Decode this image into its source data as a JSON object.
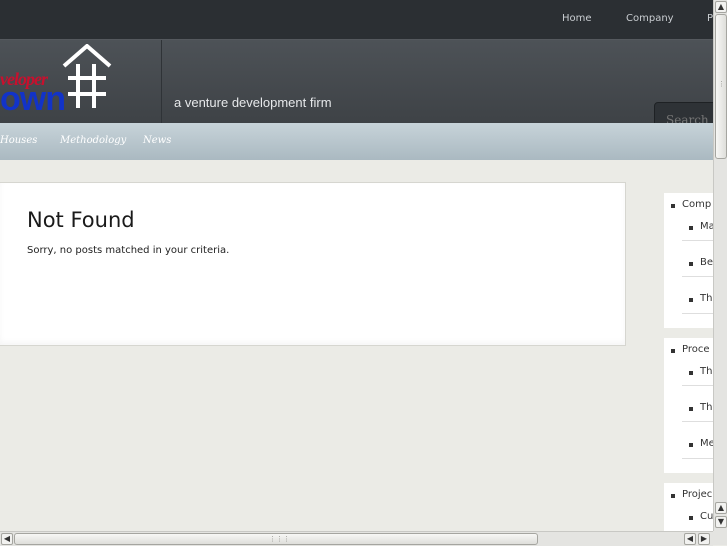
{
  "topnav": {
    "items": [
      "Home",
      "Company",
      "P"
    ]
  },
  "logo": {
    "line1": "veloper",
    "line2": "own"
  },
  "header": {
    "tagline": "a venture development firm"
  },
  "search": {
    "placeholder": "Search de"
  },
  "subnav": {
    "items": [
      "Houses",
      "Methodology",
      "News"
    ]
  },
  "main": {
    "title": "Not Found",
    "message": "Sorry, no posts matched in your criteria."
  },
  "sidebar": {
    "widgets": [
      {
        "title": "Comp",
        "items": [
          "Ma",
          "Be",
          "Th"
        ]
      },
      {
        "title": "Proce",
        "items": [
          "Th",
          "Th",
          "Me"
        ]
      },
      {
        "title": "Projec",
        "items": [
          "Cu"
        ]
      }
    ]
  },
  "icons": {
    "logo": "house-grid-icon",
    "scroll_up": "arrow-up-icon",
    "scroll_down": "arrow-down-icon",
    "scroll_left": "arrow-left-icon",
    "scroll_right": "arrow-right-icon"
  },
  "colors": {
    "topbar": "#2b2f33",
    "header": "#45494e",
    "subnav": "#b8c6cd",
    "page_bg": "#ebebe6",
    "logo_red": "#c8102e",
    "logo_blue": "#1233c8"
  }
}
